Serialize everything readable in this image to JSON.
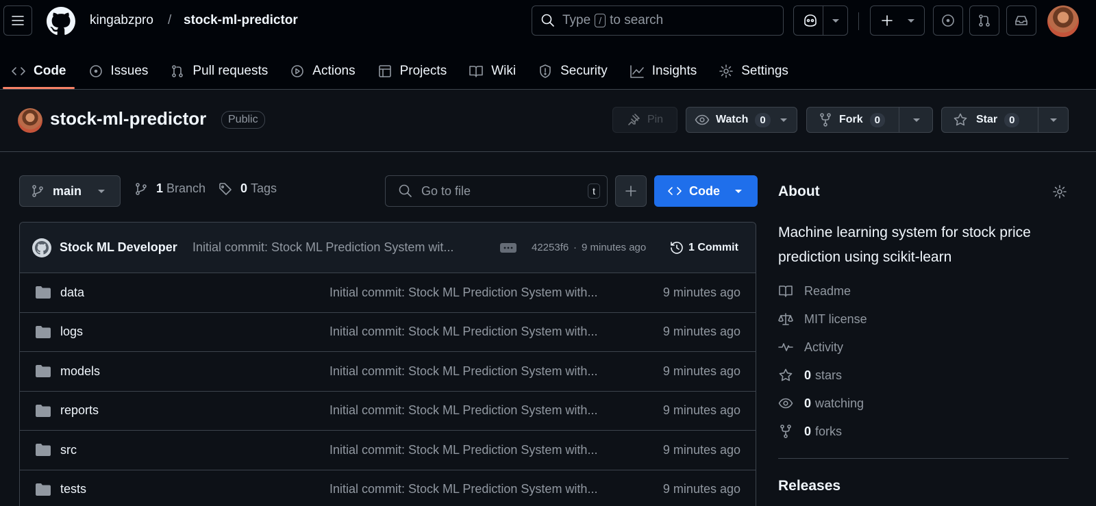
{
  "header": {
    "owner": "kingabzpro",
    "separator": "/",
    "repo": "stock-ml-predictor",
    "search_prefix": "Type",
    "search_key": "/",
    "search_suffix": "to search"
  },
  "tabs": [
    {
      "label": "Code",
      "icon": "code-icon",
      "selected": true
    },
    {
      "label": "Issues",
      "icon": "issue-icon"
    },
    {
      "label": "Pull requests",
      "icon": "pull-request-icon"
    },
    {
      "label": "Actions",
      "icon": "play-icon"
    },
    {
      "label": "Projects",
      "icon": "table-icon"
    },
    {
      "label": "Wiki",
      "icon": "book-icon"
    },
    {
      "label": "Security",
      "icon": "shield-icon"
    },
    {
      "label": "Insights",
      "icon": "graph-icon"
    },
    {
      "label": "Settings",
      "icon": "gear-icon"
    }
  ],
  "repo": {
    "name": "stock-ml-predictor",
    "visibility": "Public",
    "pin_label": "Pin",
    "watch_label": "Watch",
    "watch_count": "0",
    "fork_label": "Fork",
    "fork_count": "0",
    "star_label": "Star",
    "star_count": "0"
  },
  "toolbar": {
    "branch": "main",
    "branch_count": "1",
    "branch_label": "Branch",
    "tag_count": "0",
    "tag_label": "Tags",
    "goto_placeholder": "Go to file",
    "goto_key": "t",
    "add_label": "+",
    "code_label": "Code"
  },
  "commit": {
    "author": "Stock ML Developer",
    "message": "Initial commit: Stock ML Prediction System wit...",
    "hash": "42253f6",
    "dot": "·",
    "time": "9 minutes ago",
    "count_label": "1 Commit"
  },
  "files": [
    {
      "name": "data",
      "message": "Initial commit: Stock ML Prediction System with...",
      "time": "9 minutes ago"
    },
    {
      "name": "logs",
      "message": "Initial commit: Stock ML Prediction System with...",
      "time": "9 minutes ago"
    },
    {
      "name": "models",
      "message": "Initial commit: Stock ML Prediction System with...",
      "time": "9 minutes ago"
    },
    {
      "name": "reports",
      "message": "Initial commit: Stock ML Prediction System with...",
      "time": "9 minutes ago"
    },
    {
      "name": "src",
      "message": "Initial commit: Stock ML Prediction System with...",
      "time": "9 minutes ago"
    },
    {
      "name": "tests",
      "message": "Initial commit: Stock ML Prediction System with...",
      "time": "9 minutes ago"
    }
  ],
  "about": {
    "title": "About",
    "description": "Machine learning system for stock price prediction using scikit-learn",
    "readme": "Readme",
    "license": "MIT license",
    "activity": "Activity",
    "stars_count": "0",
    "stars_label": "stars",
    "watching_count": "0",
    "watching_label": "watching",
    "forks_count": "0",
    "forks_label": "forks",
    "releases_title": "Releases"
  },
  "colors": {
    "accent_blue": "#1f6feb",
    "tab_underline": "#f78166",
    "background": "#0d1117",
    "header_bg": "#010409"
  }
}
